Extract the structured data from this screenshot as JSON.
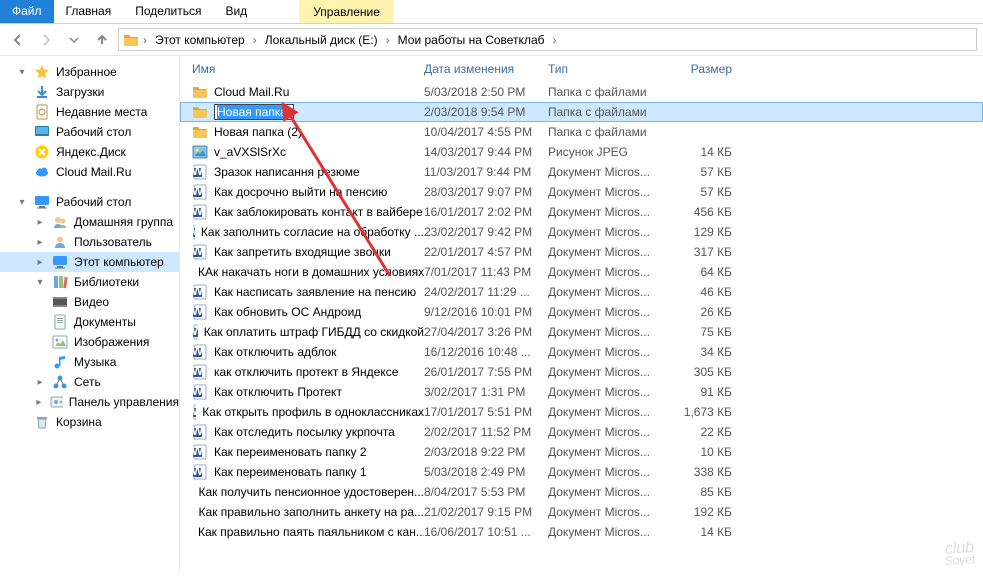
{
  "ribbon": {
    "file": "Файл",
    "tabs": [
      "Главная",
      "Поделиться",
      "Вид"
    ],
    "context": "Управление"
  },
  "breadcrumbs": [
    "Этот компьютер",
    "Локальный диск (E:)",
    "Мои работы на Советклаб"
  ],
  "nav": {
    "favorites": {
      "label": "Избранное",
      "items": [
        "Загрузки",
        "Недавние места",
        "Рабочий стол",
        "Яндекс.Диск",
        "Cloud Mail.Ru"
      ]
    },
    "desktop": {
      "label": "Рабочий стол",
      "items": [
        "Домашняя группа",
        "Пользователь",
        "Этот компьютер"
      ]
    },
    "libraries": {
      "label": "Библиотеки",
      "items": [
        "Видео",
        "Документы",
        "Изображения",
        "Музыка"
      ]
    },
    "network": {
      "label": "Сеть"
    },
    "cpanel": {
      "label": "Панель управления"
    },
    "recycle": {
      "label": "Корзина"
    }
  },
  "columns": {
    "name": "Имя",
    "date": "Дата изменения",
    "type": "Тип",
    "size": "Размер"
  },
  "rename_value": "Новая папка",
  "rows": [
    {
      "icon": "folder",
      "name": "Cloud Mail.Ru",
      "date": "5/03/2018 2:50 PM",
      "type": "Папка с файлами",
      "size": ""
    },
    {
      "icon": "folder",
      "name": "",
      "date": "2/03/2018 9:54 PM",
      "type": "Папка с файлами",
      "size": "",
      "editing": true
    },
    {
      "icon": "folder",
      "name": "Новая папка (2)",
      "date": "10/04/2017 4:55 PM",
      "type": "Папка с файлами",
      "size": ""
    },
    {
      "icon": "image",
      "name": "v_aVXSlSrXc",
      "date": "14/03/2017 9:44 PM",
      "type": "Рисунок JPEG",
      "size": "14 КБ"
    },
    {
      "icon": "word",
      "name": "Зразок написання резюме",
      "date": "11/03/2017 9:44 PM",
      "type": "Документ Micros...",
      "size": "57 КБ"
    },
    {
      "icon": "word",
      "name": "Как досрочно выйти на пенсию",
      "date": "28/03/2017 9:07 PM",
      "type": "Документ Micros...",
      "size": "57 КБ"
    },
    {
      "icon": "word",
      "name": "Как заблокировать контакт в вайбере",
      "date": "16/01/2017 2:02 PM",
      "type": "Документ Micros...",
      "size": "456 КБ"
    },
    {
      "icon": "word",
      "name": "Как заполнить согласие на обработку ...",
      "date": "23/02/2017 9:42 PM",
      "type": "Документ Micros...",
      "size": "129 КБ"
    },
    {
      "icon": "word",
      "name": "Как запретить входящие звонки",
      "date": "22/01/2017 4:57 PM",
      "type": "Документ Micros...",
      "size": "317 КБ"
    },
    {
      "icon": "word",
      "name": "КАк накачать ноги в домашних условиях",
      "date": "7/01/2017 11:43 PM",
      "type": "Документ Micros...",
      "size": "64 КБ"
    },
    {
      "icon": "word",
      "name": "Как насписать заявление на пенсию",
      "date": "24/02/2017 11:29 ...",
      "type": "Документ Micros...",
      "size": "46 КБ"
    },
    {
      "icon": "word",
      "name": "Как обновить ОС Андроид",
      "date": "9/12/2016 10:01 PM",
      "type": "Документ Micros...",
      "size": "26 КБ"
    },
    {
      "icon": "word",
      "name": "Как оплатить штраф ГИБДД со скидкой",
      "date": "27/04/2017 3:26 PM",
      "type": "Документ Micros...",
      "size": "75 КБ"
    },
    {
      "icon": "word",
      "name": "Как отключить адблок",
      "date": "16/12/2016 10:48 ...",
      "type": "Документ Micros...",
      "size": "34 КБ"
    },
    {
      "icon": "word",
      "name": "как отключить протект в Яндексе",
      "date": "26/01/2017 7:55 PM",
      "type": "Документ Micros...",
      "size": "305 КБ"
    },
    {
      "icon": "word",
      "name": "Как отключить Протект",
      "date": "3/02/2017 1:31 PM",
      "type": "Документ Micros...",
      "size": "91 КБ"
    },
    {
      "icon": "word",
      "name": "Как открыть профиль в одноклассниках",
      "date": "17/01/2017 5:51 PM",
      "type": "Документ Micros...",
      "size": "1,673 КБ"
    },
    {
      "icon": "word",
      "name": "Как отследить посылку укрпочта",
      "date": "2/02/2017 11:52 PM",
      "type": "Документ Micros...",
      "size": "22 КБ"
    },
    {
      "icon": "word",
      "name": "Как переименовать папку 2",
      "date": "2/03/2018 9:22 PM",
      "type": "Документ Micros...",
      "size": "10 КБ"
    },
    {
      "icon": "word",
      "name": "Как переименовать папку 1",
      "date": "5/03/2018 2:49 PM",
      "type": "Документ Micros...",
      "size": "338 КБ"
    },
    {
      "icon": "word",
      "name": "Как получить пенсионное удостоверен...",
      "date": "8/04/2017 5:53 PM",
      "type": "Документ Micros...",
      "size": "85 КБ"
    },
    {
      "icon": "word",
      "name": "Как правильно заполнить анкету на ра...",
      "date": "21/02/2017 9:15 PM",
      "type": "Документ Micros...",
      "size": "192 КБ"
    },
    {
      "icon": "word",
      "name": "Как правильно паять паяльником с кан...",
      "date": "16/06/2017 10:51 ...",
      "type": "Документ Micros...",
      "size": "14 КБ"
    }
  ],
  "watermark": {
    "top": "club",
    "bottom": "Sovet"
  }
}
